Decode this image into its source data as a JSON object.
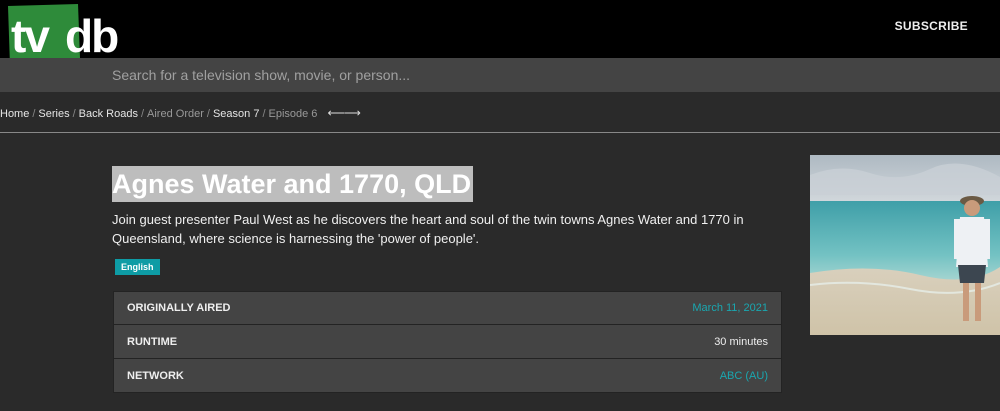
{
  "header": {
    "logo": "tvdb",
    "subscribe_label": "SUBSCRIBE"
  },
  "search": {
    "placeholder": "Search for a television show, movie, or person..."
  },
  "breadcrumb": {
    "home": "Home",
    "series": "Series",
    "show": "Back Roads",
    "order": "Aired Order",
    "season": "Season 7",
    "episode": "Episode 6"
  },
  "episode": {
    "title": "Agnes Water and 1770, QLD",
    "description": "Join guest presenter Paul West as he discovers the heart and soul of the twin towns Agnes Water and 1770 in Queensland, where science is harnessing the 'power of people'.",
    "language": "English"
  },
  "info": [
    {
      "label": "ORIGINALLY AIRED",
      "value": "March 11, 2021"
    },
    {
      "label": "RUNTIME",
      "value": "30 minutes"
    },
    {
      "label": "NETWORK",
      "value": "ABC (AU)"
    }
  ],
  "colors": {
    "logo_green": "#2e8b3a",
    "accent_teal": "#0e9ca5",
    "link_teal": "#1aa7b0",
    "topbar": "#000000",
    "background": "#2a2a2a"
  }
}
